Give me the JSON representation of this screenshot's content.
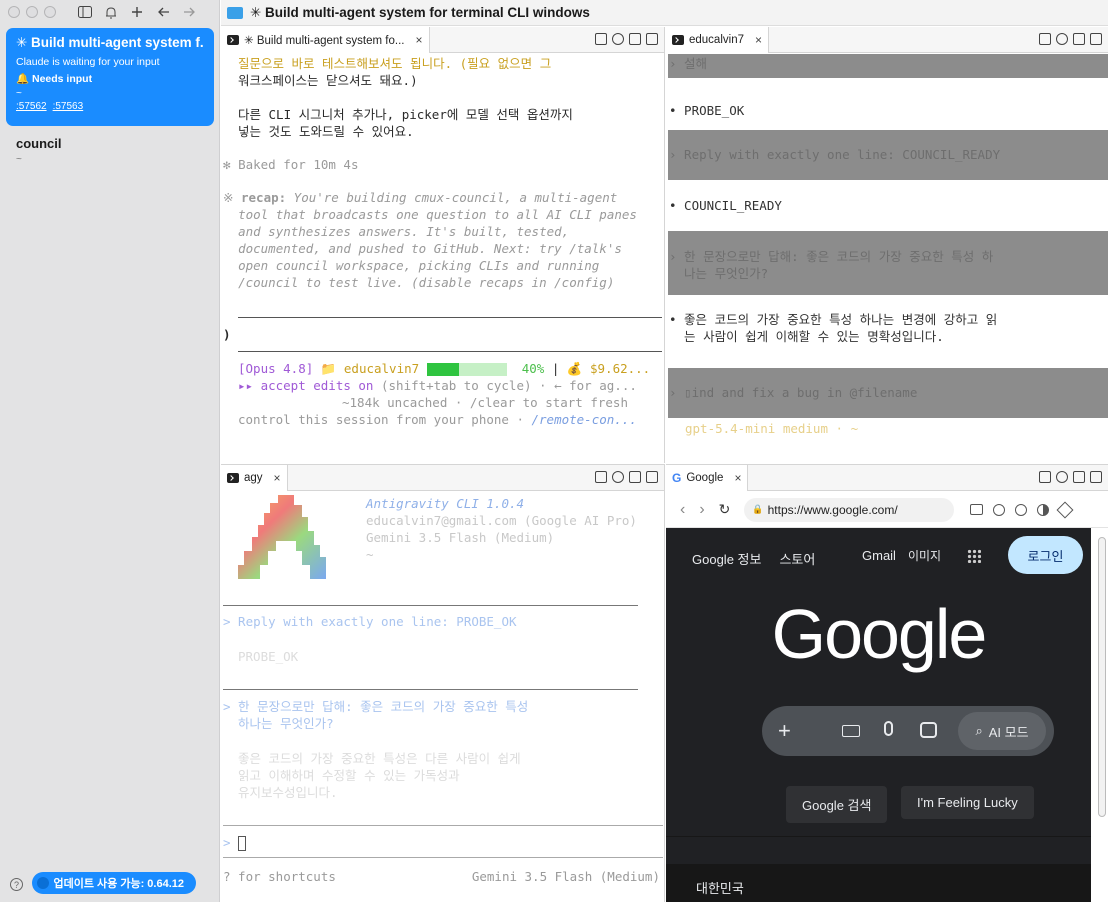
{
  "sidebar": {
    "workspaces": [
      {
        "title": "✳ Build multi-agent system f...",
        "subtitle": "Claude is waiting for your input",
        "status": "🔔 Needs input",
        "path": "~",
        "ports": [
          ":57562",
          ":57563"
        ]
      },
      {
        "title": "council",
        "path": "~"
      }
    ],
    "update_label": "업데이트 사용 가능: 0.64.12",
    "help": "?"
  },
  "window_title": "✳ Build multi-agent system for terminal CLI windows",
  "pane_claude": {
    "tab": "✳ Build multi-agent system fo...",
    "lines_ko": [
      "질문으로 바로 테스트해보셔도 됩니다. (필요 없으면 그",
      "워크스페이스는 닫으셔도 돼요.)",
      "",
      "다른 CLI 시그니처 추가나, picker에 모델 선택 옵션까지",
      "넣는 것도 도와드릴 수 있어요."
    ],
    "baked": "Baked for 10m 4s",
    "recap_label": "recap:",
    "recap_lines": [
      " You're building cmux-council, a multi-agent",
      "tool that broadcasts one question to all AI CLI panes",
      "and synthesizes answers. It's built, tested,",
      "documented, and pushed to GitHub. Next: try /talk's",
      "open council workspace, picking CLIs and running",
      "/council to test live. (disable recaps in /config)"
    ],
    "prompt": ")",
    "status_model": "[Opus 4.8]",
    "status_user": "educalvin7",
    "status_pct": "40%",
    "status_cost": "💰 $9.62...",
    "progress": 0.4,
    "accept": "▸▸ accept edits on",
    "accept_hint": " (shift+tab to cycle) · ← for ag...",
    "uncached": "~184k uncached · /clear to start fresh",
    "control": "control this session from your phone · ",
    "remote": "/remote-con..."
  },
  "pane_codex": {
    "tab": "educalvin7",
    "lines": [
      {
        "text": "› 설해",
        "hl": true
      },
      {
        "text": "• PROBE_OK",
        "hl": false
      },
      {
        "text": "› Reply with exactly one line: COUNCIL_READY",
        "hl": true
      },
      {
        "text": "• COUNCIL_READY",
        "hl": false
      },
      {
        "text": "› 한 문장으로만 답해: 좋은 코드의 가장 중요한 특성 하\n  나는 무엇인가?",
        "hl": true
      },
      {
        "text": "• 좋은 코드의 가장 중요한 특성 하나는 변경에 강하고 읽\n  는 사람이 쉽게 이해할 수 있는 명확성입니다.",
        "hl": false
      },
      {
        "text": "› ▯ind and fix a bug in @filename",
        "hl": true
      }
    ],
    "model": "gpt-5.4-mini medium · ~"
  },
  "pane_agy": {
    "tab": "agy",
    "name": "Antigravity CLI 1.0.4",
    "email": "educalvin7@gmail.com (Google AI Pro)",
    "model": "Gemini 3.5 Flash (Medium)",
    "tilde": "~",
    "q1": "> Reply with exactly one line: PROBE_OK",
    "a1": "PROBE_OK",
    "q2": "> 한 문장으로만 답해: 좋은 코드의 가장 중요한 특성\n  하나는 무엇인가?",
    "a2": "좋은 코드의 가장 중요한 특성은 다른 사람이 쉽게\n읽고 이해하며 수정할 수 있는 가독성과\n유지보수성입니다.",
    "prompt": ">",
    "footer_left": "? for shortcuts",
    "footer_right": "Gemini 3.5 Flash (Medium)"
  },
  "pane_browser": {
    "tab": "Google",
    "url": "https://www.google.com/",
    "links": [
      "Google 정보",
      "스토어"
    ],
    "right_links": [
      "Gmail",
      "이미지"
    ],
    "login": "로그인",
    "logo": "Google",
    "ai_mode": "AI 모드",
    "btn_search": "Google 검색",
    "btn_lucky": "I'm Feeling Lucky",
    "country": "대한민국"
  }
}
